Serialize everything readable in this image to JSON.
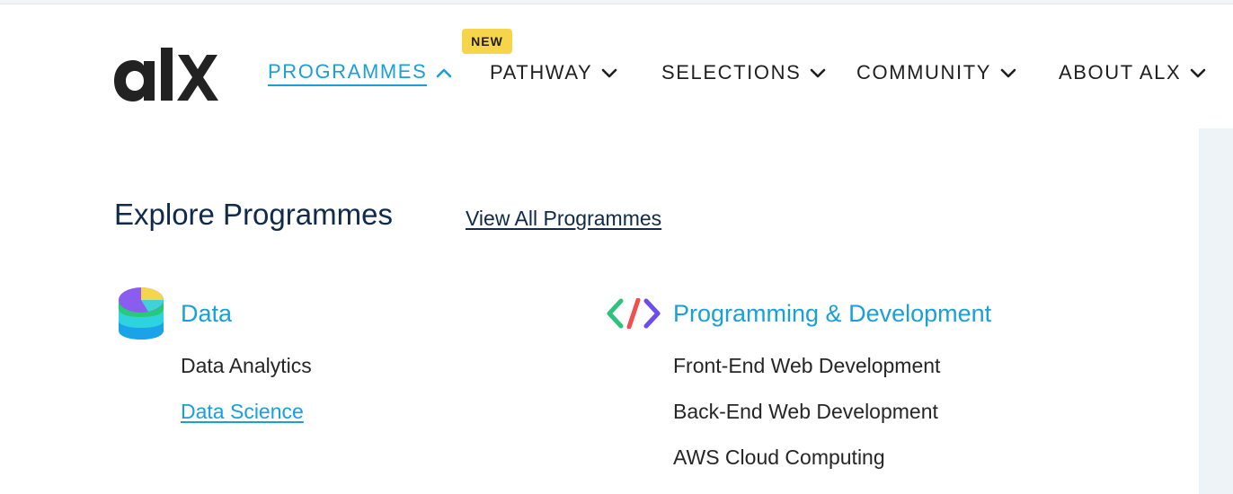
{
  "header": {
    "logo_text": "alx",
    "new_badge": "NEW",
    "nav": [
      {
        "label": "PROGRAMMES",
        "active": true
      },
      {
        "label": "PATHWAY",
        "active": false
      },
      {
        "label": "SELECTIONS",
        "active": false
      },
      {
        "label": "COMMUNITY",
        "active": false
      },
      {
        "label": "ABOUT ALX",
        "active": false
      }
    ]
  },
  "dropdown": {
    "title": "Explore Programmes",
    "view_all": "View All Programmes",
    "categories": [
      {
        "title": "Data",
        "icon": "database-icon",
        "items": [
          "Data Analytics",
          "Data Science"
        ]
      },
      {
        "title": "Programming & Development",
        "icon": "code-icon",
        "items": [
          "Front-End Web Development",
          "Back-End Web Development",
          "AWS Cloud Computing"
        ]
      }
    ]
  },
  "colors": {
    "accent": "#1a9fd9",
    "dark_navy": "#0f2a4a",
    "badge_yellow": "#f7d54a",
    "text": "#262626"
  }
}
